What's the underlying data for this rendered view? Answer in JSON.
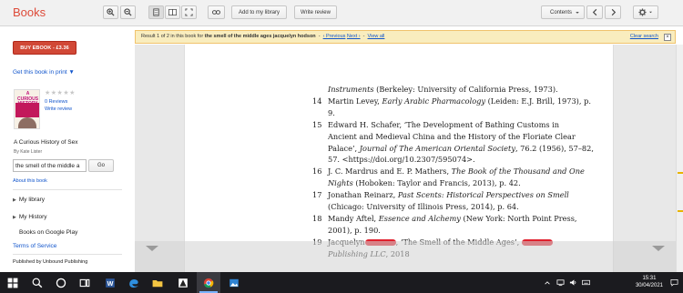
{
  "app": {
    "title": "Books"
  },
  "toolbar": {
    "add_library": "Add to my library",
    "write_review": "Write review",
    "contents": "Contents"
  },
  "sidebar": {
    "buy": "BUY EBOOK - £3.36",
    "get_print": "Get this book in print ▼",
    "reviews": "0 Reviews",
    "write_review": "Write review",
    "cover_text": "A CURIOUS HISTORY OF SEX",
    "book_title": "A Curious History of Sex",
    "byline": "By Kate Lister",
    "search_value": "the smell of the middle a",
    "go": "Go",
    "about": "About this book",
    "my_library": "My library",
    "my_history": "My History",
    "google_play": "Books on Google Play",
    "terms": "Terms of Service",
    "publisher": "Published by Unbound Publishing"
  },
  "banner": {
    "prefix": "Result 1 of 2 in this book for",
    "query": "the smell of the middle ages jacquelyn hodson",
    "previous": "‹ Previous",
    "next": "Next ›",
    "view_all": "View all",
    "clear": "Clear search",
    "close": "×"
  },
  "page_text": [
    {
      "num": "",
      "text": "Instruments (Berkeley: University of California Press, 1973)."
    },
    {
      "num": "14",
      "text": "Martin Levey, Early Arabic Pharmacology (Leiden: E.J. Brill, 1973), p."
    },
    {
      "num": "",
      "text": "9."
    },
    {
      "num": "15",
      "text": "Edward H. Schafer, ‘The Development of Bathing Customs in"
    },
    {
      "num": "",
      "text": "Ancient and Medieval China and the History of the Floriate Clear"
    },
    {
      "num": "",
      "text": "Palace’, Journal of The American Oriental Society, 76.2 (1956), 57–82,"
    },
    {
      "num": "",
      "text": "57. <https://doi.org/10.2307/595074>."
    },
    {
      "num": "16",
      "text": "J. C. Mardrus and E. P. Mathers, The Book of the Thousand and One"
    },
    {
      "num": "",
      "text": "Nights (Hoboken: Taylor and Francis, 2013), p. 42."
    },
    {
      "num": "17",
      "text": "Jonathan Reinarz, Past Scents: Historical Perspectives on Smell"
    },
    {
      "num": "",
      "text": "(Chicago: University of Illinois Press, 2014), p. 64."
    },
    {
      "num": "18",
      "text": "Mandy Aftel, Essence and Alchemy (New York: North Point Press,"
    },
    {
      "num": "",
      "text": "2001), p. 190."
    },
    {
      "num": "19",
      "text": "Jacquelyn",
      "after": ", ‘The Smell of the Middle Ages’,"
    },
    {
      "num": "",
      "text": "Publishing LLC, 2018"
    }
  ],
  "clock": {
    "time": "15:31",
    "date": "30/04/2021"
  },
  "colors": {
    "brand": "#dd4b39",
    "buy": "#d14836",
    "link": "#1155cc",
    "banner": "#f9edbe",
    "redaction": "#e0202d"
  }
}
